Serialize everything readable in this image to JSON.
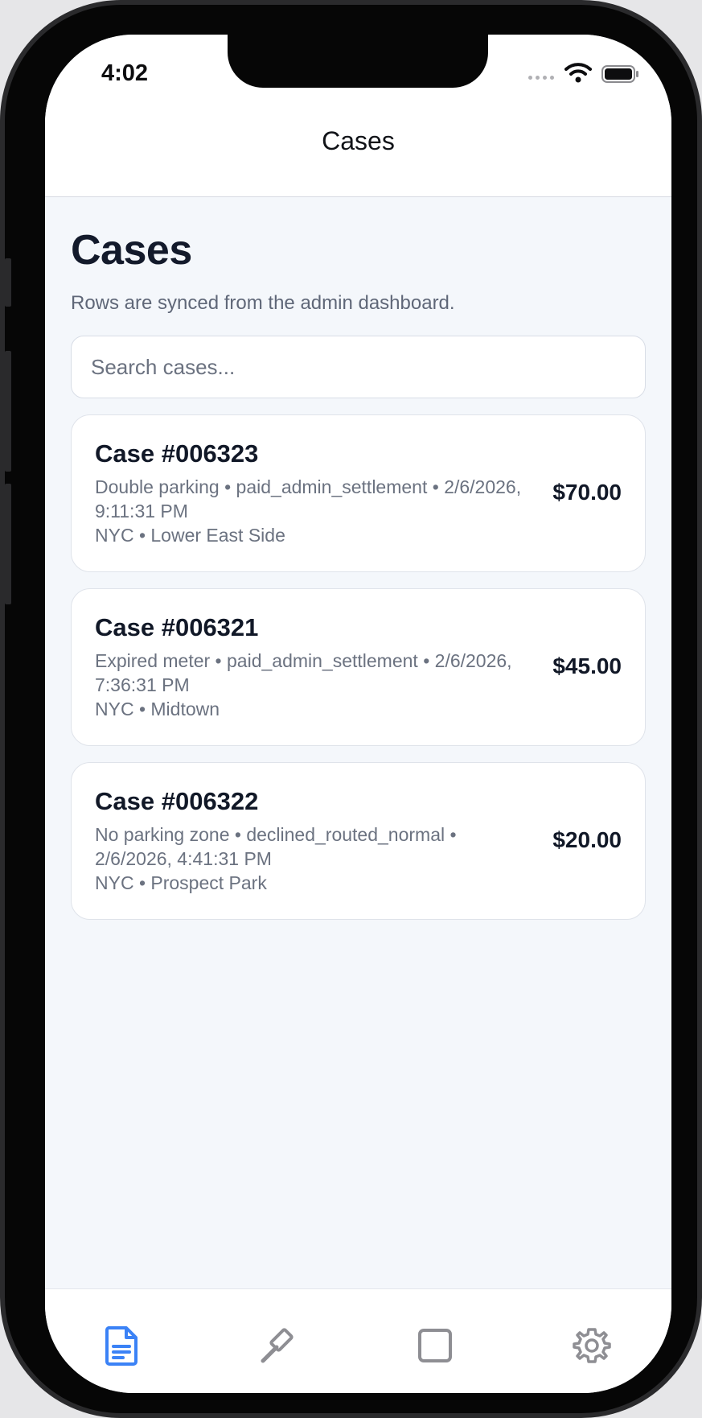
{
  "status_bar": {
    "time": "4:02"
  },
  "nav": {
    "title": "Cases"
  },
  "header": {
    "title": "Cases",
    "subtitle": "Rows are synced from the admin dashboard."
  },
  "search": {
    "placeholder": "Search cases..."
  },
  "cases": [
    {
      "title": "Case #006323",
      "meta": "Double parking • paid_admin_settlement • 2/6/2026, 9:11:31 PM",
      "location": "NYC • Lower East Side",
      "amount": "$70.00"
    },
    {
      "title": "Case #006321",
      "meta": "Expired meter • paid_admin_settlement • 2/6/2026, 7:36:31 PM",
      "location": "NYC • Midtown",
      "amount": "$45.00"
    },
    {
      "title": "Case #006322",
      "meta": "No parking zone • declined_routed_normal • 2/6/2026, 4:41:31 PM",
      "location": "NYC • Prospect Park",
      "amount": "$20.00"
    }
  ],
  "tabs": [
    {
      "icon": "document-icon",
      "active": true
    },
    {
      "icon": "gavel-icon",
      "active": false
    },
    {
      "icon": "square-icon",
      "active": false
    },
    {
      "icon": "gear-icon",
      "active": false
    }
  ],
  "colors": {
    "accent": "#3b82f6",
    "inactive_icon": "#8e8e93",
    "background": "#f4f7fb"
  }
}
